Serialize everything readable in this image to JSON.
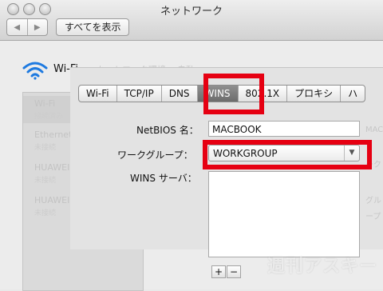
{
  "window": {
    "title": "ネットワーク"
  },
  "toolbar": {
    "back_label": "◀",
    "forward_label": "▶",
    "show_all_label": "すべてを表示"
  },
  "header": {
    "interface_name": "Wi-Fi",
    "ghost_location_label": "ネットワーク環境：",
    "ghost_location_value": "自動"
  },
  "sidebar": {
    "items": [
      {
        "name": "Wi-Fi",
        "status": "接続済み"
      },
      {
        "name": "Ethernet",
        "status": "未接続"
      },
      {
        "name": "HUAWEI ...odem",
        "status": "未接続"
      },
      {
        "name": "HUAWEI ...r-Pad",
        "status": "未接続"
      }
    ]
  },
  "tabs": [
    {
      "label": "Wi-Fi"
    },
    {
      "label": "TCP/IP"
    },
    {
      "label": "DNS"
    },
    {
      "label": "WINS",
      "active": true
    },
    {
      "label": "802.1X"
    },
    {
      "label": "プロキシ"
    },
    {
      "label": "ハ"
    }
  ],
  "form": {
    "netbios_label": "NetBIOS 名：",
    "netbios_value": "MACBOOK",
    "workgroup_label": "ワークグループ：",
    "workgroup_value": "WORKGROUP",
    "wins_label": "WINS サーバ：",
    "add_button": "+",
    "remove_button": "−",
    "right_hint_1": "MAC",
    "right_hint_2": "ーク",
    "right_hint_3": "グル",
    "right_hint_4": "ープ"
  },
  "watermark": {
    "text": "週刊アスキー"
  },
  "accents": {
    "highlight": "#e60012",
    "active_tab": "#7a7a7a"
  }
}
